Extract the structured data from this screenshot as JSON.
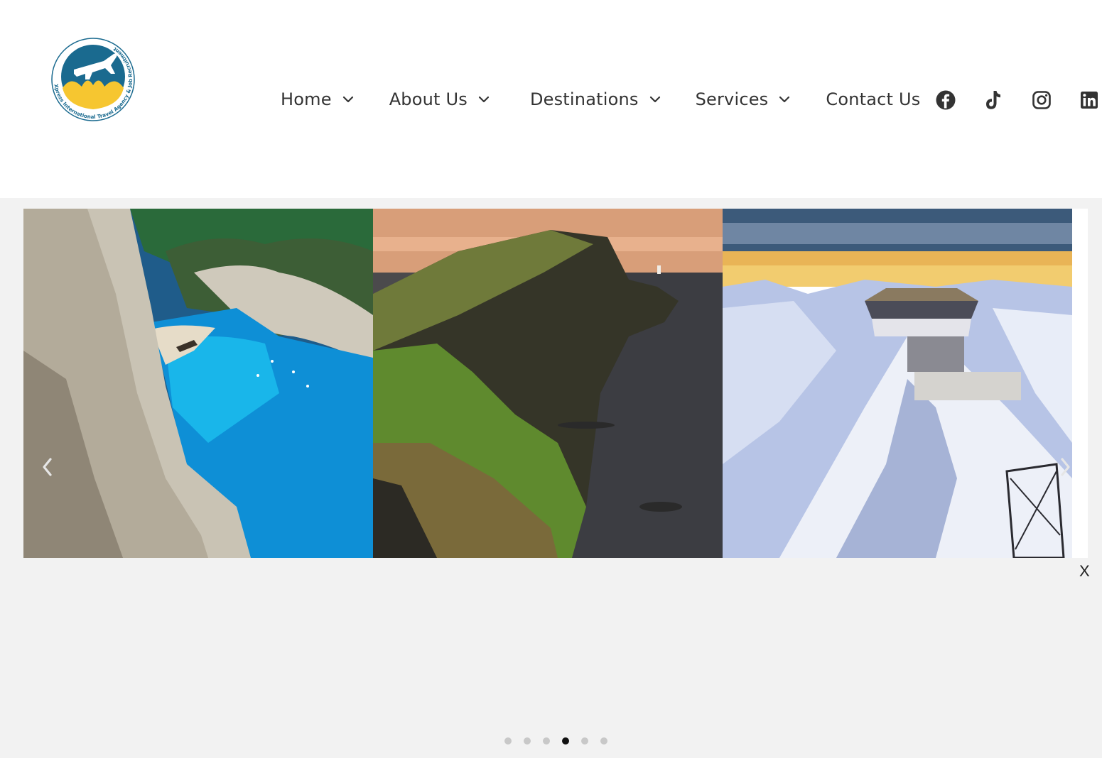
{
  "brand": {
    "logo_text": "Xpress International Travel Agency & Job Recruitment",
    "colors": {
      "blue": "#1a6a8f",
      "yellow": "#f6c630"
    }
  },
  "nav": {
    "items": [
      {
        "label": "Home",
        "has_dropdown": true
      },
      {
        "label": "About Us",
        "has_dropdown": true
      },
      {
        "label": "Destinations",
        "has_dropdown": true
      },
      {
        "label": "Services",
        "has_dropdown": true
      },
      {
        "label": "Contact Us",
        "has_dropdown": false
      }
    ]
  },
  "social": [
    {
      "icon": "facebook-icon"
    },
    {
      "icon": "tiktok-icon"
    },
    {
      "icon": "instagram-icon"
    },
    {
      "icon": "linkedin-icon"
    }
  ],
  "slider": {
    "slides": [
      {
        "scene": "Navagio beach cove with turquoise water and white cliffs"
      },
      {
        "scene": "Grassy sea cliffs with lighthouse at sunset"
      },
      {
        "scene": "Snowy alpine summit with revolving restaurant"
      }
    ],
    "prev_icon": "chevron-left-icon",
    "next_icon": "chevron-right-icon",
    "close_label": "X",
    "dot_count": 6,
    "active_dot": 4
  }
}
